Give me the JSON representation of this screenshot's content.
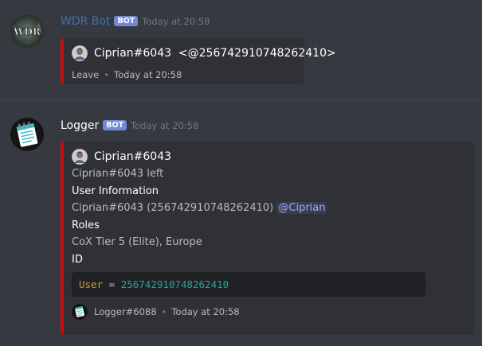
{
  "colors": {
    "embed_border": "#d20808",
    "bot_tag": "#7289da",
    "bg": "#36393f",
    "embed_bg": "#2f3136"
  },
  "messages": [
    {
      "username": "WDR Bot",
      "username_color": "#3e70b0",
      "bot_tag": "BOT",
      "timestamp": "Today at 20:58",
      "avatar_icon": "wdr-logo-icon",
      "avatar_text": "WDR",
      "embed": {
        "author": "Ciprian#6043  <@256742910748262410>",
        "author_icon": "user-avatar-icon",
        "footer_text": "Leave",
        "footer_time": "Today at 20:58"
      }
    },
    {
      "username": "Logger",
      "username_color": "#ffffff",
      "bot_tag": "BOT",
      "timestamp": "Today at 20:58",
      "avatar_icon": "notepad-icon",
      "embed": {
        "author": "Ciprian#6043",
        "author_icon": "user-avatar-icon",
        "description": "Ciprian#6043 left",
        "fields": [
          {
            "name": "User Information",
            "value": "Ciprian#6043 (256742910748262410)",
            "mention": "@Ciprian"
          },
          {
            "name": "Roles",
            "value": "CoX Tier 5 (Elite), Europe"
          },
          {
            "name": "ID"
          }
        ],
        "code": {
          "key": "User",
          "op": " = ",
          "value": "256742910748262410"
        },
        "footer_icon": "notepad-icon",
        "footer_text": "Logger#6088",
        "footer_time": "Today at 20:58"
      }
    }
  ]
}
